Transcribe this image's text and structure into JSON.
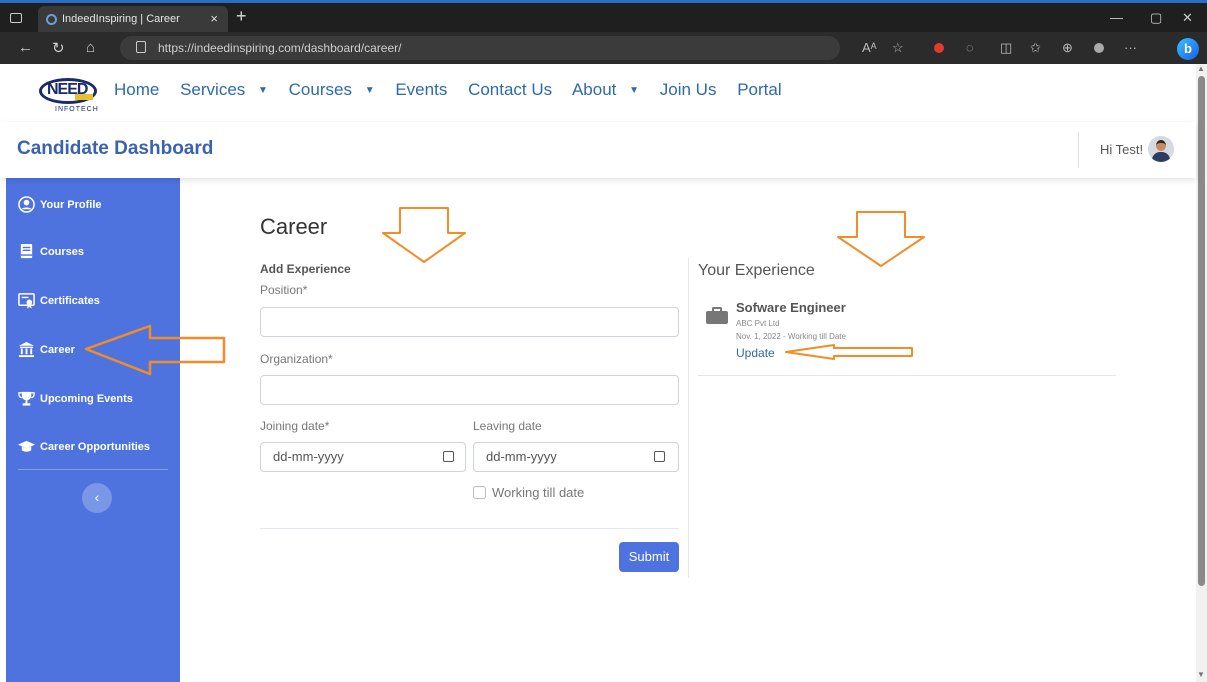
{
  "browser": {
    "tab_title": "IndeedInspiring | Career",
    "url": "https://indeedinspiring.com/dashboard/career/"
  },
  "site": {
    "logo_text": "NEED",
    "logo_sub": "INFOTECH",
    "nav": [
      {
        "label": "Home",
        "dropdown": false
      },
      {
        "label": "Services",
        "dropdown": true
      },
      {
        "label": "Courses",
        "dropdown": true
      },
      {
        "label": "Events",
        "dropdown": false
      },
      {
        "label": "Contact Us",
        "dropdown": false
      },
      {
        "label": "About",
        "dropdown": true
      },
      {
        "label": "Join Us",
        "dropdown": false
      },
      {
        "label": "Portal",
        "dropdown": false
      }
    ]
  },
  "dashboard": {
    "title": "Candidate Dashboard",
    "greeting": "Hi Test!"
  },
  "sidebar": {
    "items": [
      {
        "label": "Your Profile",
        "icon": "user-circle-icon"
      },
      {
        "label": "Courses",
        "icon": "book-icon"
      },
      {
        "label": "Certificates",
        "icon": "certificate-icon"
      },
      {
        "label": "Career",
        "icon": "university-icon"
      },
      {
        "label": "Upcoming Events",
        "icon": "trophy-icon"
      },
      {
        "label": "Career Opportunities",
        "icon": "graduation-cap-icon"
      }
    ],
    "toggle": "‹"
  },
  "career": {
    "heading": "Career",
    "form_title": "Add Experience",
    "position_label": "Position*",
    "organization_label": "Organization*",
    "joining_label": "Joining date*",
    "leaving_label": "Leaving date",
    "date_placeholder": "dd-mm-yyyy",
    "working_till_label": "Working till date",
    "submit_label": "Submit"
  },
  "experience": {
    "heading": "Your Experience",
    "items": [
      {
        "title": "Sofware Engineer",
        "company": "ABC Pvt Ltd",
        "dates": "Nov. 1, 2022 - Working till Date",
        "update_label": "Update"
      }
    ]
  },
  "colors": {
    "accent": "#4e73df",
    "annotation": "#f28c28"
  }
}
